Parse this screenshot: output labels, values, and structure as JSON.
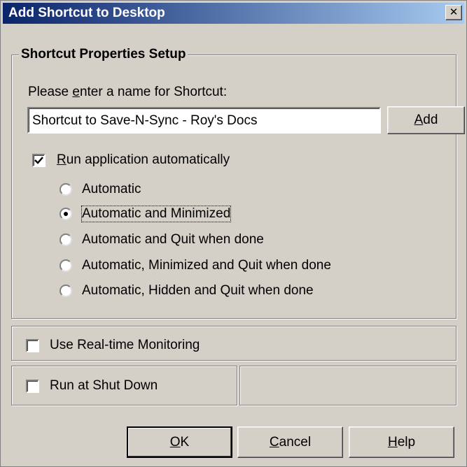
{
  "window": {
    "title": "Add Shortcut to Desktop",
    "close_glyph": "✕"
  },
  "group": {
    "legend": "Shortcut Properties Setup",
    "name_label": {
      "pre": "Please ",
      "mnemonic": "e",
      "post": "nter a name for Shortcut:"
    },
    "name_value": "Shortcut to Save-N-Sync - Roy's Docs",
    "add_button": {
      "mnemonic": "A",
      "rest": "dd"
    },
    "run_auto": {
      "checked": true,
      "mnemonic": "R",
      "rest": "un application automatically"
    },
    "options": [
      {
        "label": "Automatic",
        "selected": false
      },
      {
        "label": "Automatic and Minimized",
        "selected": true
      },
      {
        "label": "Automatic and Quit when done",
        "selected": false
      },
      {
        "label": "Automatic, Minimized and Quit when done",
        "selected": false
      },
      {
        "label": "Automatic, Hidden and Quit when done",
        "selected": false
      }
    ]
  },
  "realtime": {
    "label": "Use Real-time Monitoring",
    "checked": false
  },
  "shutdown": {
    "label": "Run at Shut Down",
    "checked": false
  },
  "buttons": {
    "ok": {
      "mnemonic": "O",
      "rest": "K"
    },
    "cancel": {
      "mnemonic": "C",
      "rest": "ancel"
    },
    "help": {
      "mnemonic": "H",
      "rest": "elp"
    }
  },
  "colors": {
    "title_start": "#0a246a",
    "title_end": "#a6caf0",
    "face": "#d4d0c8"
  },
  "icons": {
    "check": "check-mark-icon",
    "close": "close-icon"
  }
}
